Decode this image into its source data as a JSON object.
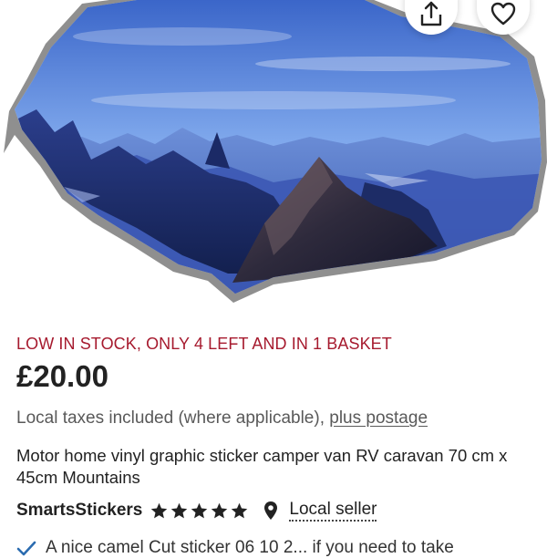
{
  "hero": {
    "image_subject": "mountain-landscape",
    "share_icon": "share-icon",
    "favorite_icon": "heart-icon"
  },
  "listing": {
    "stock_notice": "LOW IN STOCK, ONLY 4 LEFT AND IN 1 BASKET",
    "price": "£20.00",
    "taxes_text": "Local taxes included (where applicable),",
    "postage_link": "plus postage",
    "title": "Motor home vinyl graphic sticker camper van RV caravan 70 cm x 45cm Mountains"
  },
  "seller": {
    "name": "SmartsStickers",
    "rating": 5,
    "rating_max": 5,
    "location_icon": "map-pin-icon",
    "local_label": "Local seller"
  },
  "highlight": {
    "icon": "check-icon",
    "text": "A nice camel Cut sticker 06 10 2... if you need to take"
  },
  "colors": {
    "stock_red": "#a61a2e",
    "star": "#222222"
  }
}
